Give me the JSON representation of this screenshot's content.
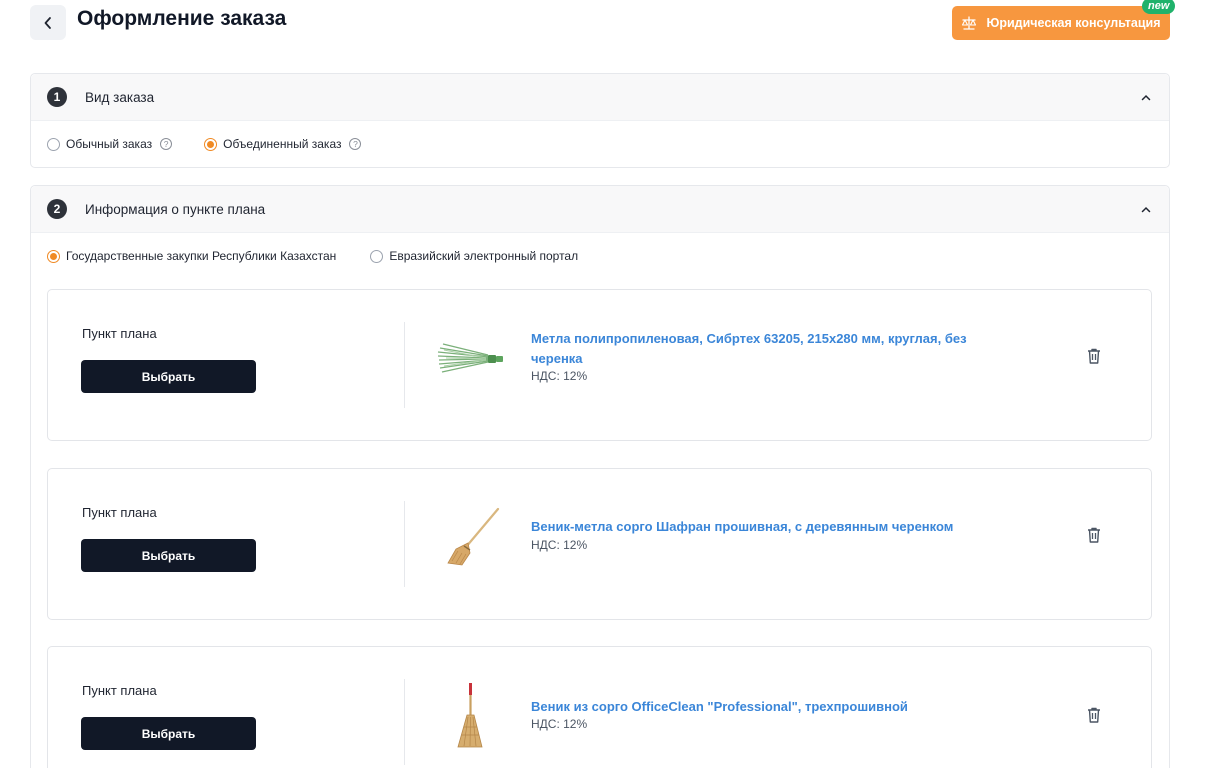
{
  "header": {
    "title": "Оформление заказа",
    "legal_button": "Юридическая консультация",
    "badge": "new"
  },
  "section1": {
    "number": "1",
    "title": "Вид заказа",
    "options": [
      {
        "label": "Обычный заказ",
        "selected": false
      },
      {
        "label": "Объединенный заказ",
        "selected": true
      }
    ]
  },
  "section2": {
    "number": "2",
    "title": "Информация о пункте плана",
    "options": [
      {
        "label": "Государственные закупки Республики Казахстан",
        "selected": true
      },
      {
        "label": "Евразийский электронный портал",
        "selected": false
      }
    ]
  },
  "items": [
    {
      "label": "Пункт плана",
      "button": "Выбрать",
      "name": "Метла полипропиленовая, Сибртех 63205, 215х280 мм, круглая, без черенка",
      "vat": "НДС: 12%"
    },
    {
      "label": "Пункт плана",
      "button": "Выбрать",
      "name": "Веник-метла сорго Шафран прошивная, с деревянным черенком",
      "vat": "НДС: 12%"
    },
    {
      "label": "Пункт плана",
      "button": "Выбрать",
      "name": "Веник из сорго OfficeClean \"Professional\", трехпрошивной",
      "vat": "НДС: 12%"
    }
  ],
  "colors": {
    "accent_orange": "#f7973f",
    "radio_orange": "#f08a24",
    "badge_green": "#20b26b",
    "dark_button": "#111827",
    "link_blue": "#3b86d8"
  },
  "icons": [
    "chevron-left-icon",
    "scales-icon",
    "chevron-up-icon",
    "help-icon",
    "trash-icon"
  ]
}
